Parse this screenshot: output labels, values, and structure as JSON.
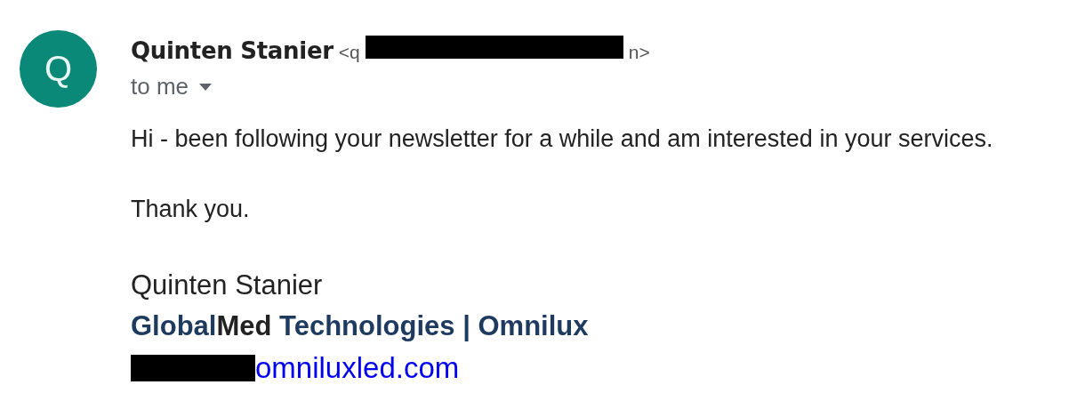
{
  "sender": {
    "avatar_letter": "Q",
    "name": "Quinten Stanier",
    "email_start": "<q",
    "email_end": "n>"
  },
  "recipient": {
    "label": "to me"
  },
  "body": {
    "paragraphs": [
      "Hi - been following your newsletter for a while and am interested in your services.",
      "Thank you."
    ]
  },
  "signature": {
    "name": "Quinten Stanier",
    "company": [
      {
        "text": "Global",
        "color": "#1f3a5f"
      },
      {
        "text": "Med",
        "color": "#222222"
      },
      {
        "text": " Technologies | Omnilux",
        "color": "#1f3a5f"
      }
    ],
    "email_link": "omniluxled.com"
  }
}
